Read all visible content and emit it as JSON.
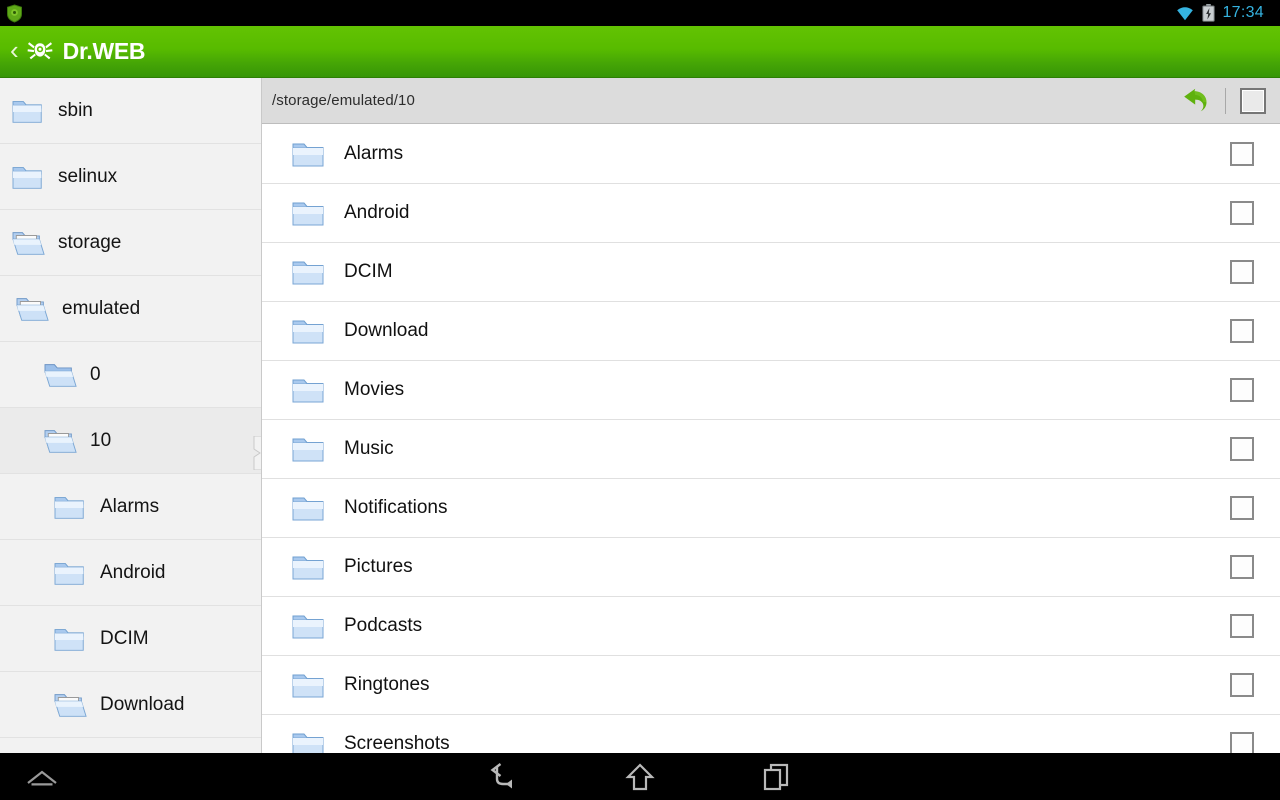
{
  "statusbar": {
    "notification_icon": "drweb-shield-icon",
    "wifi_icon": "wifi-icon",
    "battery_icon": "battery-charging-icon",
    "time": "17:34",
    "time_color": "#35b3e0"
  },
  "appbar": {
    "back_chevron": "‹",
    "logo_icon": "drweb-spider-icon",
    "brand": "Dr.WEB",
    "bg_color_top": "#63c302",
    "bg_color_bottom": "#379607"
  },
  "sidebar": {
    "items": [
      {
        "label": "sbin",
        "icon": "folder-closed-icon",
        "depth": 0,
        "selected": false
      },
      {
        "label": "selinux",
        "icon": "folder-closed-icon",
        "depth": 0,
        "selected": false
      },
      {
        "label": "storage",
        "icon": "folder-open-icon",
        "depth": 0,
        "selected": false
      },
      {
        "label": "emulated",
        "icon": "folder-open-icon",
        "depth": 1,
        "selected": false
      },
      {
        "label": "0",
        "icon": "folder-open-blue-icon",
        "depth": 2,
        "selected": false
      },
      {
        "label": "10",
        "icon": "folder-open-icon",
        "depth": 2,
        "selected": true
      },
      {
        "label": "Alarms",
        "icon": "folder-closed-icon",
        "depth": 3,
        "selected": false
      },
      {
        "label": "Android",
        "icon": "folder-closed-icon",
        "depth": 3,
        "selected": false
      },
      {
        "label": "DCIM",
        "icon": "folder-closed-icon",
        "depth": 3,
        "selected": false
      },
      {
        "label": "Download",
        "icon": "folder-open-icon",
        "depth": 3,
        "selected": false
      }
    ]
  },
  "pathbar": {
    "path": "/storage/emulated/10",
    "undo_icon": "undo-arrow-icon",
    "select_all_checkbox": {
      "name": "select-all-checkbox",
      "checked": false
    }
  },
  "filelist": {
    "rows": [
      {
        "name": "Alarms",
        "icon": "folder-closed-icon",
        "checked": false
      },
      {
        "name": "Android",
        "icon": "folder-closed-icon",
        "checked": false
      },
      {
        "name": "DCIM",
        "icon": "folder-closed-icon",
        "checked": false
      },
      {
        "name": "Download",
        "icon": "folder-closed-icon",
        "checked": false
      },
      {
        "name": "Movies",
        "icon": "folder-closed-icon",
        "checked": false
      },
      {
        "name": "Music",
        "icon": "folder-closed-icon",
        "checked": false
      },
      {
        "name": "Notifications",
        "icon": "folder-closed-icon",
        "checked": false
      },
      {
        "name": "Pictures",
        "icon": "folder-closed-icon",
        "checked": false
      },
      {
        "name": "Podcasts",
        "icon": "folder-closed-icon",
        "checked": false
      },
      {
        "name": "Ringtones",
        "icon": "folder-closed-icon",
        "checked": false
      },
      {
        "name": "Screenshots",
        "icon": "folder-closed-icon",
        "checked": false
      }
    ]
  },
  "navbar": {
    "pull_icon": "chevron-up-icon",
    "back_icon": "back-arrow-icon",
    "home_icon": "home-icon",
    "recents_icon": "recent-apps-icon"
  }
}
